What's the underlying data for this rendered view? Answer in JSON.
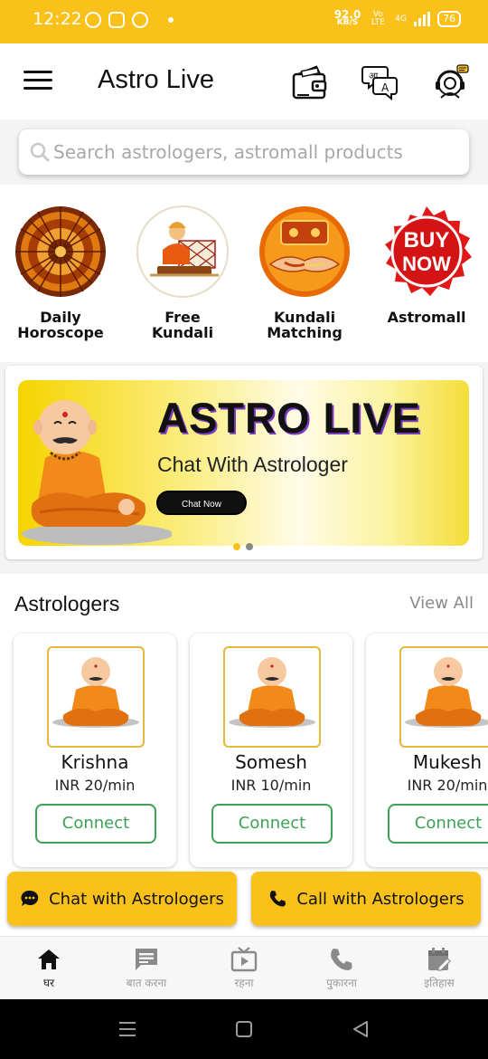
{
  "status_bar": {
    "time": "12:22",
    "net_speed": "92.0",
    "net_unit": "KB/S",
    "volte": "Vo LTE",
    "network": "4G",
    "battery": "76"
  },
  "header": {
    "title": "Astro Live"
  },
  "search": {
    "placeholder": "Search astrologers, astromall products"
  },
  "categories": [
    {
      "label": "Daily\nHoroscope",
      "icon": "zodiac-wheel-icon"
    },
    {
      "label": "Free\nKundali",
      "icon": "kundali-icon"
    },
    {
      "label": "Kundali\nMatching",
      "icon": "matching-hands-icon"
    },
    {
      "label": "Astromall",
      "icon": "buy-now-badge-icon"
    }
  ],
  "buy_badge": {
    "line1": "BUY",
    "line2": "NOW"
  },
  "banner": {
    "title": "ASTRO LIVE",
    "subtitle": "Chat With Astrologer",
    "button": "Chat Now",
    "slide_count": 2,
    "active_slide": 0
  },
  "astrologers": {
    "title": "Astrologers",
    "view_all": "View All",
    "list": [
      {
        "name": "Krishna",
        "rate": "INR 20/min",
        "button": "Connect"
      },
      {
        "name": "Somesh",
        "rate": "INR 10/min",
        "button": "Connect"
      },
      {
        "name": "Mukesh",
        "rate": "INR 20/min",
        "button": "Connect"
      }
    ]
  },
  "actions": {
    "chat": "Chat with Astrologers",
    "call": "Call with Astrologers"
  },
  "bottom_nav": [
    {
      "label": "घर",
      "icon": "home-icon",
      "active": true
    },
    {
      "label": "बात करना",
      "icon": "chat-icon",
      "active": false
    },
    {
      "label": "रहना",
      "icon": "live-tv-icon",
      "active": false
    },
    {
      "label": "पुकारना",
      "icon": "phone-icon",
      "active": false
    },
    {
      "label": "इतिहास",
      "icon": "history-icon",
      "active": false
    }
  ],
  "colors": {
    "brand_yellow": "#f9c11a",
    "connect_green": "#3ea155",
    "active_nav": "#222222"
  }
}
